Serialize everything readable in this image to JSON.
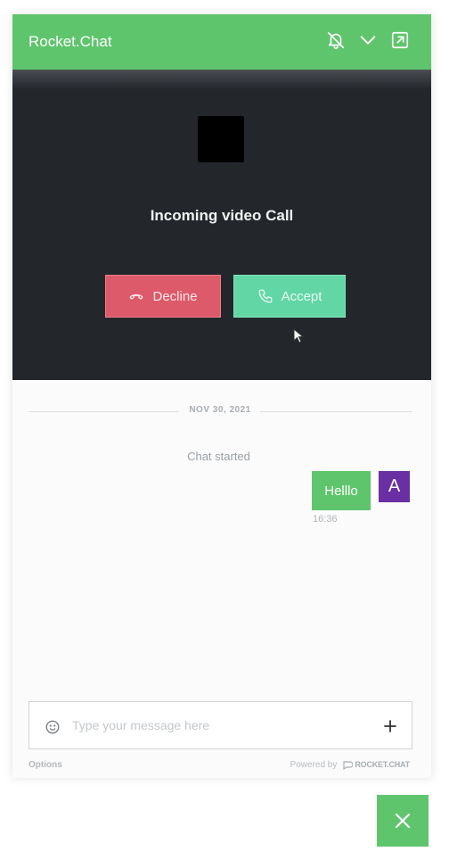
{
  "header": {
    "title": "Rocket.Chat",
    "icons": [
      "bell-off-icon",
      "chevron-down-icon",
      "popout-icon"
    ]
  },
  "call": {
    "title": "Incoming video Call",
    "decline_label": "Decline",
    "accept_label": "Accept",
    "decline_color": "#dc5a6a",
    "accept_color": "#62d6a5"
  },
  "messages": {
    "date": "NOV 30, 2021",
    "system": "Chat started",
    "items": [
      {
        "text": "Helllo",
        "time": "16:36",
        "avatar_initial": "A",
        "avatar_color": "#6a2fa3"
      }
    ]
  },
  "composer": {
    "placeholder": "Type your message here",
    "value": ""
  },
  "footer": {
    "options_label": "Options",
    "powered_by": "Powered by",
    "brand": "ROCKET.CHAT"
  },
  "colors": {
    "brand": "#5fc56d",
    "video_bg": "#23272c"
  }
}
